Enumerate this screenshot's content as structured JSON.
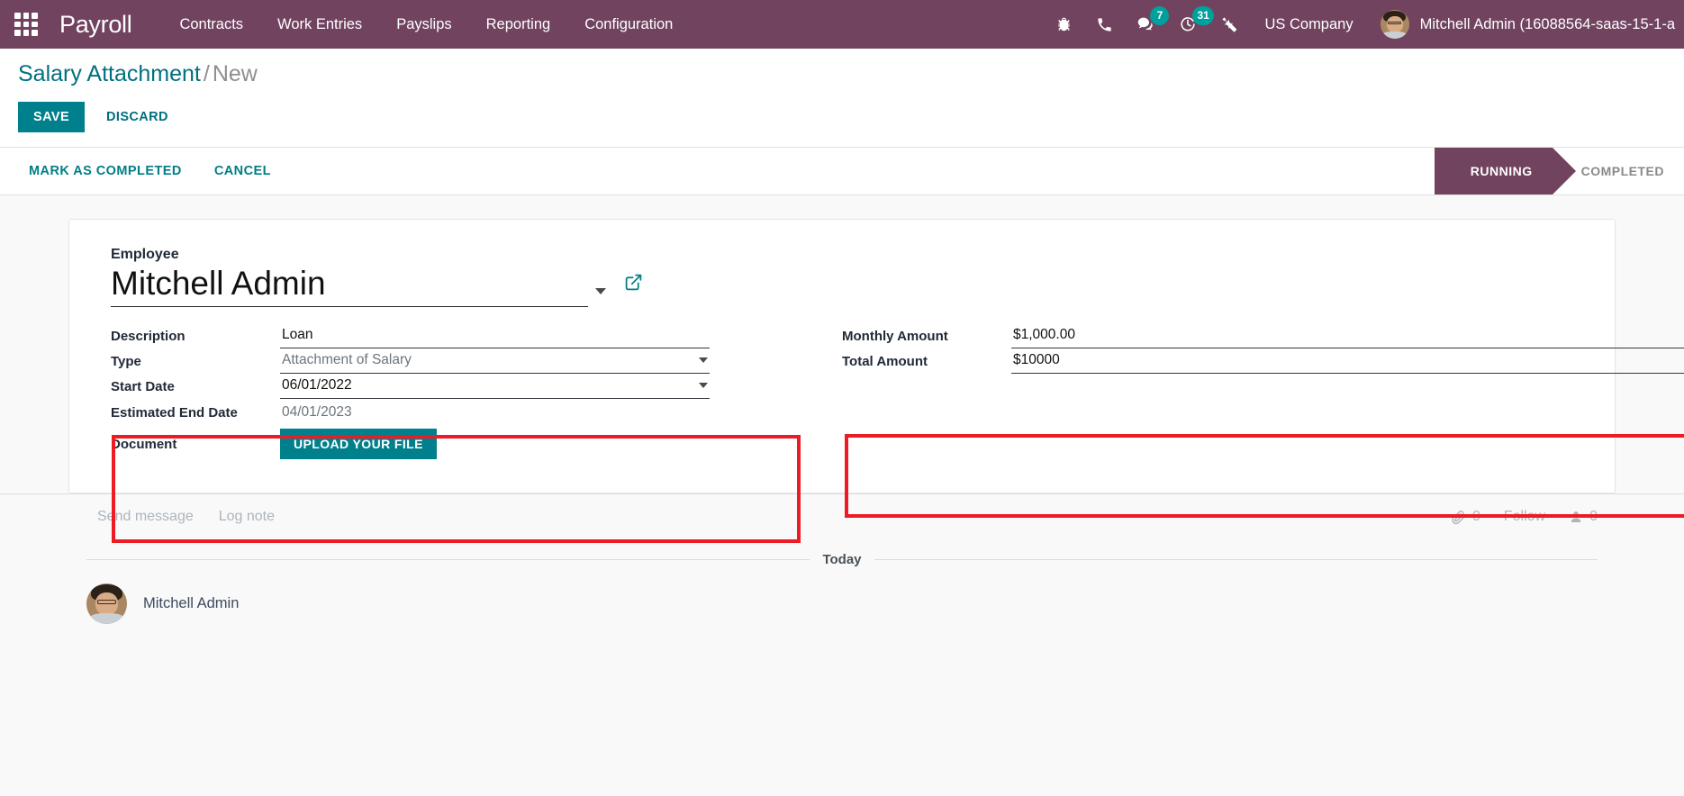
{
  "navbar": {
    "apps_icon": "apps-grid-icon",
    "brand": "Payroll",
    "menu": [
      {
        "label": "Contracts"
      },
      {
        "label": "Work Entries"
      },
      {
        "label": "Payslips"
      },
      {
        "label": "Reporting"
      },
      {
        "label": "Configuration"
      }
    ],
    "icons": [
      {
        "name": "bug-icon",
        "badge": ""
      },
      {
        "name": "phone-icon",
        "badge": ""
      },
      {
        "name": "messages-icon",
        "badge": "7"
      },
      {
        "name": "activities-clock-icon",
        "badge": "31"
      },
      {
        "name": "tools-icon",
        "badge": ""
      }
    ],
    "company": "US Company",
    "user": "Mitchell Admin (16088564-saas-15-1-a",
    "bg_color": "#71435f",
    "badge_color": "#00a09d"
  },
  "control_panel": {
    "breadcrumb_root": "Salary Attachment",
    "breadcrumb_sep": "/",
    "breadcrumb_current": "New",
    "save_label": "SAVE",
    "discard_label": "DISCARD",
    "accent_color": "#00808c"
  },
  "status_bar": {
    "mark_completed_label": "MARK AS COMPLETED",
    "cancel_label": "CANCEL",
    "stages": [
      {
        "label": "RUNNING",
        "active": true
      },
      {
        "label": "COMPLETED",
        "active": false
      }
    ]
  },
  "form": {
    "employee_label": "Employee",
    "employee_value": "Mitchell Admin",
    "external_link_icon": "external-link-icon",
    "dropdown_icon": "chevron-down-icon",
    "left_fields": [
      {
        "label": "Description",
        "value": "Loan",
        "type": "text",
        "muted": false
      },
      {
        "label": "Type",
        "value": "Attachment of Salary",
        "type": "select",
        "muted": true
      },
      {
        "label": "Start Date",
        "value": "06/01/2022",
        "type": "date",
        "muted": false
      },
      {
        "label": "Estimated End Date",
        "value": "04/01/2023",
        "type": "readonly",
        "muted": true
      }
    ],
    "document_label": "Document",
    "upload_label": "UPLOAD YOUR FILE",
    "right_fields": [
      {
        "label": "Monthly Amount",
        "value": "$1,000.00"
      },
      {
        "label": "Total Amount",
        "value": "$10000"
      }
    ],
    "annotation_color": "#ed1c24"
  },
  "chatter": {
    "send_message": "Send message",
    "log_note": "Log note",
    "attachment_icon": "paperclip-icon",
    "attachment_count": "0",
    "follow_label": "Follow",
    "followers_icon": "user-icon",
    "followers_count": "0",
    "today_label": "Today",
    "message_author": "Mitchell Admin"
  }
}
